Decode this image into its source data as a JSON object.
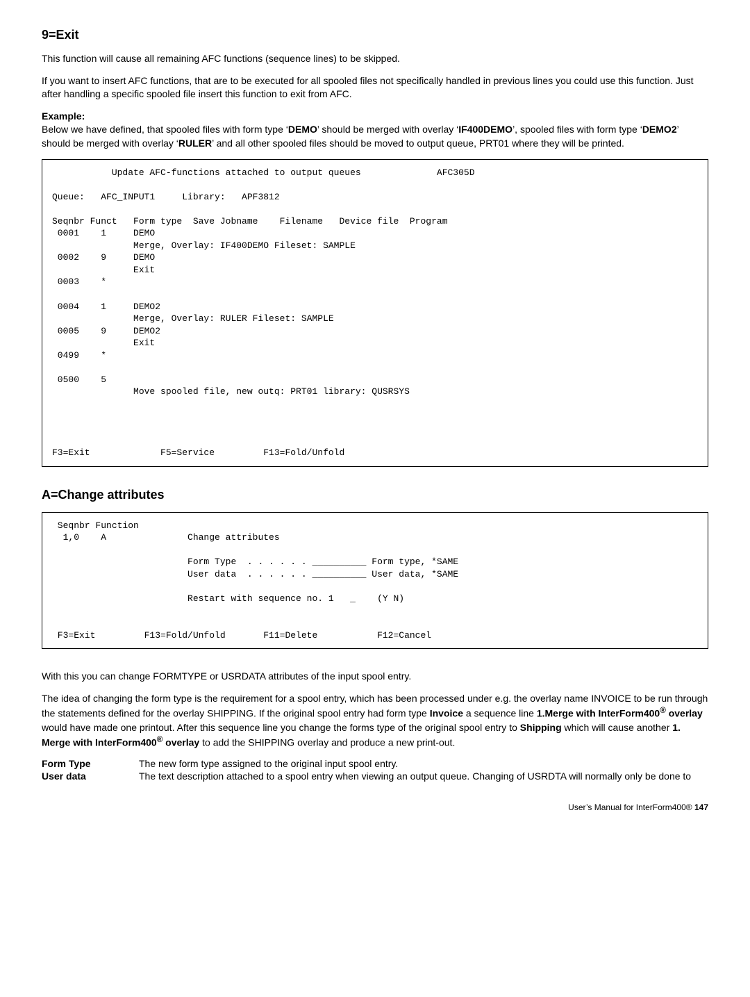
{
  "section1": {
    "heading": "9=Exit",
    "p1": "This function will cause all remaining AFC functions (sequence lines) to be skipped.",
    "p2": "If you want to insert AFC functions, that are to be executed for all spooled files not specifically handled in previous lines you could use this function. Just after handling a specific spooled file insert this function to exit from AFC.",
    "example_label": "Example:",
    "example_text_pre": "Below we have defined, that spooled files with form type ‘",
    "example_b1": "DEMO",
    "example_text_mid1": "’ should be merged with overlay ‘",
    "example_b2": "IF400DEMO",
    "example_text_mid2": "’, spooled files with form type ‘",
    "example_b3": "DEMO2",
    "example_text_mid3": "’ should be merged with overlay ‘",
    "example_b4": "RULER",
    "example_text_post": "’ and all other spooled files should be moved to output queue, PRT01 where they will be printed."
  },
  "codeblock1": "           Update AFC-functions attached to output queues              AFC305D\n\nQueue:   AFC_INPUT1     Library:   APF3812\n\nSeqnbr Funct   Form type  Save Jobname    Filename   Device file  Program\n 0001    1     DEMO\n               Merge, Overlay: IF400DEMO Fileset: SAMPLE\n 0002    9     DEMO\n               Exit\n 0003    *\n\n 0004    1     DEMO2\n               Merge, Overlay: RULER Fileset: SAMPLE\n 0005    9     DEMO2\n               Exit\n 0499    *\n\n 0500    5\n               Move spooled file, new outq: PRT01 library: QUSRSYS\n\n\n\n\nF3=Exit             F5=Service         F13=Fold/Unfold",
  "section2": {
    "heading": "A=Change attributes"
  },
  "codeblock2": " Seqnbr Function\n  1,0    A               Change attributes\n\n                         Form Type  . . . . . . __________ Form type, *SAME\n                         User data  . . . . . . __________ User data, *SAME\n\n                         Restart with sequence no. 1   _    (Y N)\n\n\n F3=Exit         F13=Fold/Unfold       F11=Delete           F12=Cancel     ",
  "section3": {
    "p1": "With this you can change FORMTYPE or USRDATA attributes of the input spool entry.",
    "p2_pre": "The idea of changing the form type is the requirement for a spool entry, which has been processed under e.g. the overlay name INVOICE to be run through the statements defined for the overlay SHIPPING. If the original spool entry had form type ",
    "p2_b1": "Invoice",
    "p2_mid1": " a sequence line ",
    "p2_b2": "1.Merge with InterForm400",
    "p2_sup1": "®",
    "p2_b2b": " overlay",
    "p2_mid2": " would have made one printout. After this sequence line you change the forms type of the original spool entry to ",
    "p2_b3": "Shipping",
    "p2_mid3": " which will cause another ",
    "p2_b4": "1. Merge with InterForm400",
    "p2_sup2": "®",
    "p2_b4b": " overlay",
    "p2_post": " to add the SHIPPING overlay and produce a new print-out."
  },
  "defs": {
    "t1": "Form Type",
    "d1": "The new form type assigned to the original input spool entry.",
    "t2": "User data",
    "d2": "The text description attached to a spool entry when viewing an output queue. Changing of USRDTA will normally only be done to"
  },
  "footer": {
    "text_pre": "User’s Manual for InterForm400®  ",
    "page": "147"
  }
}
